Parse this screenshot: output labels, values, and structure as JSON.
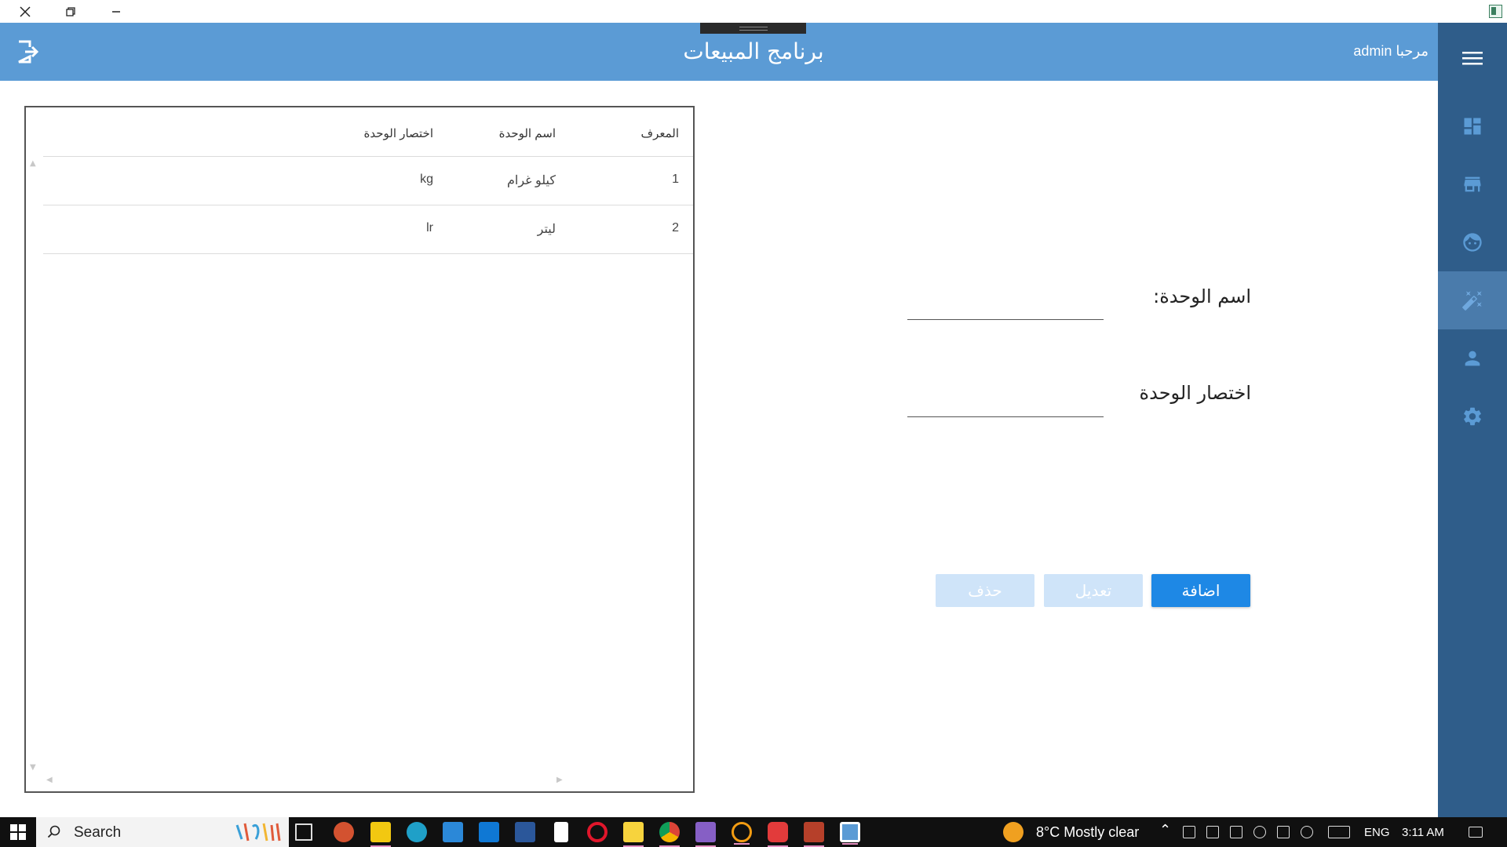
{
  "window": {
    "close_icon": "close-icon",
    "restore_icon": "restore-icon",
    "minimize_icon": "minimize-icon"
  },
  "header": {
    "title": "برنامج المبيعات",
    "welcome": "مرحبا admin",
    "exit_icon": "exit-icon",
    "menu_icon": "hamburger-icon",
    "color": "#5b9bd5"
  },
  "sidebar": {
    "color": "#2f5d8a",
    "items": [
      {
        "icon": "dashboard-icon"
      },
      {
        "icon": "store-icon"
      },
      {
        "icon": "customer-face-icon"
      },
      {
        "icon": "magic-wand-icon",
        "active": true
      },
      {
        "icon": "person-icon"
      },
      {
        "icon": "gear-icon"
      }
    ]
  },
  "grid": {
    "columns": [
      "المعرف",
      "اسم الوحدة",
      "اختصار الوحدة"
    ],
    "rows": [
      {
        "id": "1",
        "name": "كيلو غرام",
        "abbr": "kg"
      },
      {
        "id": "2",
        "name": "ليتر",
        "abbr": "lr"
      }
    ]
  },
  "form": {
    "unit_name_label": "اسم الوحدة:",
    "unit_name_value": "",
    "unit_abbr_label": "اختصار الوحدة",
    "unit_abbr_value": ""
  },
  "buttons": {
    "add": "اضافة",
    "edit": "تعديل",
    "delete": "حذف",
    "primary_color": "#1e88e5"
  },
  "taskbar": {
    "search_label": "Search",
    "weather": "8°C  Mostly clear",
    "language": "ENG",
    "time": "3:11 AM"
  }
}
